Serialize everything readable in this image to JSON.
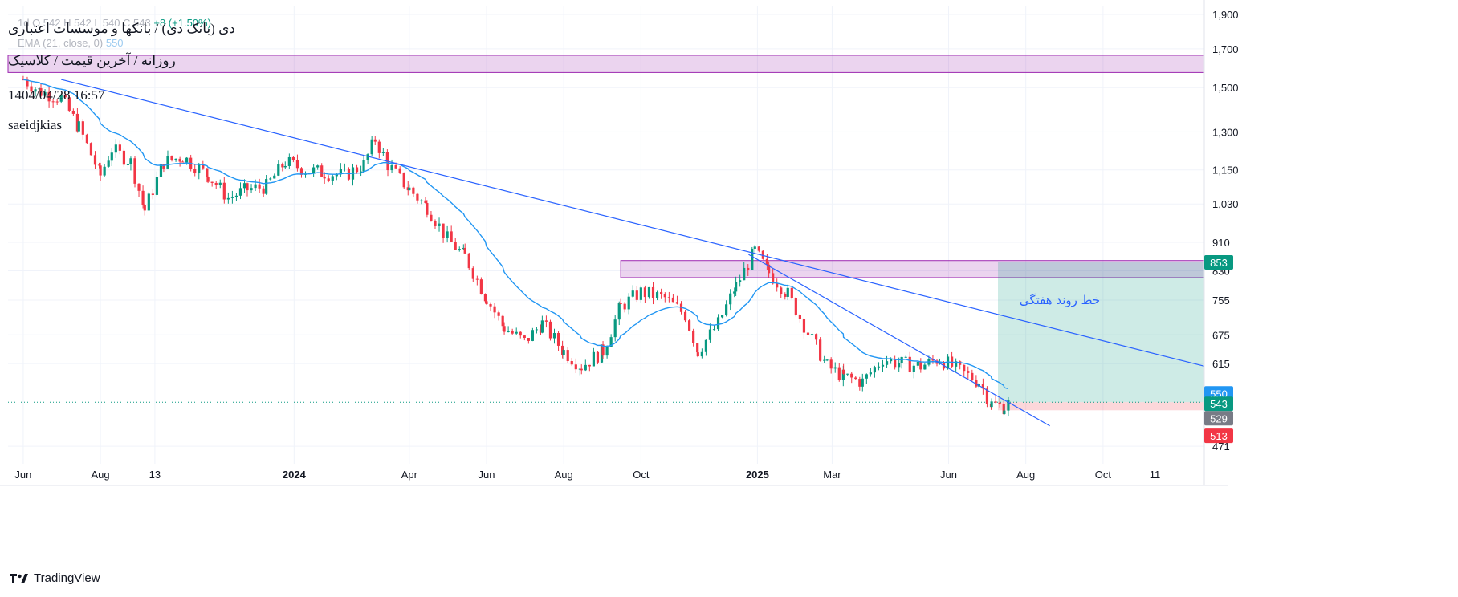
{
  "header": {
    "symbol_ghost": "1d  O  542  H  542  L  540  C  543",
    "change_ghost": "+8 (+1.50%)",
    "ema_label": "EMA (21, close, 0)",
    "ema_value": "550",
    "title_line1": "دی (بانک دی) / بانکها و موسسات اعتباری",
    "title_line2": "روزانه / آخرین قیمت / کلاسیک",
    "datetime": "1404/04/28 16:57",
    "author": "saeidjkias"
  },
  "brand": {
    "name": "TradingView",
    "icon": "tradingview-logo-icon"
  },
  "annotation": {
    "text": "خط روند هفتگی"
  },
  "price_badges": [
    {
      "value": "853",
      "color": "#089981"
    },
    {
      "value": "550",
      "color": "#2196f3"
    },
    {
      "value": "543",
      "color": "#089981"
    },
    {
      "value": "529",
      "color": "#787b86"
    },
    {
      "value": "513",
      "color": "#f23645"
    }
  ],
  "colors": {
    "up": "#089981",
    "down": "#f23645",
    "ema": "#2196f3",
    "trendline": "#2962ff",
    "zone": "#9c27b0",
    "target": "#089981",
    "stop": "#f23645"
  },
  "chart_data": {
    "type": "candlestick",
    "y_scale": "log",
    "ylim": [
      445,
      1950
    ],
    "y_ticks": [
      1900,
      1700,
      1500,
      1300,
      1150,
      1030,
      910,
      830,
      755,
      675,
      615,
      471
    ],
    "y_tick_labels": [
      "1,900",
      "1,700",
      "1,500",
      "1,300",
      "1,150",
      "1,030",
      "910",
      "830",
      "755",
      "675",
      "615",
      "471"
    ],
    "x_range": [
      "2023-05-20",
      "2025-12-20"
    ],
    "x_ticks": [
      {
        "label": "Jun",
        "date": "2023-06-01",
        "bold": false
      },
      {
        "label": "Aug",
        "date": "2023-08-01",
        "bold": false
      },
      {
        "label": "13",
        "date": "2023-09-13",
        "bold": false
      },
      {
        "label": "2024",
        "date": "2024-01-01",
        "bold": true
      },
      {
        "label": "Apr",
        "date": "2024-04-01",
        "bold": false
      },
      {
        "label": "Jun",
        "date": "2024-06-01",
        "bold": false
      },
      {
        "label": "Aug",
        "date": "2024-08-01",
        "bold": false
      },
      {
        "label": "Oct",
        "date": "2024-10-01",
        "bold": false
      },
      {
        "label": "2025",
        "date": "2025-01-01",
        "bold": true
      },
      {
        "label": "Mar",
        "date": "2025-03-01",
        "bold": false
      },
      {
        "label": "Jun",
        "date": "2025-06-01",
        "bold": false
      },
      {
        "label": "Aug",
        "date": "2025-08-01",
        "bold": false
      },
      {
        "label": "Oct",
        "date": "2025-10-01",
        "bold": false
      },
      {
        "label": "11",
        "date": "2025-11-11",
        "bold": false
      }
    ],
    "price_path": [
      [
        "2023-06-01",
        1540
      ],
      [
        "2023-06-15",
        1480
      ],
      [
        "2023-07-01",
        1450
      ],
      [
        "2023-07-15",
        1320
      ],
      [
        "2023-08-01",
        1130
      ],
      [
        "2023-08-10",
        1230
      ],
      [
        "2023-08-25",
        1180
      ],
      [
        "2023-09-05",
        1010
      ],
      [
        "2023-09-20",
        1180
      ],
      [
        "2023-10-05",
        1200
      ],
      [
        "2023-10-25",
        1130
      ],
      [
        "2023-11-10",
        1050
      ],
      [
        "2023-11-25",
        1080
      ],
      [
        "2023-12-10",
        1090
      ],
      [
        "2023-12-25",
        1180
      ],
      [
        "2024-01-10",
        1150
      ],
      [
        "2024-01-25",
        1140
      ],
      [
        "2024-02-10",
        1130
      ],
      [
        "2024-02-25",
        1170
      ],
      [
        "2024-03-05",
        1270
      ],
      [
        "2024-03-15",
        1170
      ],
      [
        "2024-04-01",
        1080
      ],
      [
        "2024-04-15",
        1020
      ],
      [
        "2024-05-01",
        920
      ],
      [
        "2024-05-15",
        870
      ],
      [
        "2024-06-01",
        760
      ],
      [
        "2024-06-15",
        690
      ],
      [
        "2024-07-01",
        660
      ],
      [
        "2024-07-15",
        700
      ],
      [
        "2024-08-01",
        640
      ],
      [
        "2024-08-15",
        610
      ],
      [
        "2024-09-01",
        640
      ],
      [
        "2024-09-15",
        740
      ],
      [
        "2024-10-01",
        775
      ],
      [
        "2024-10-20",
        760
      ],
      [
        "2024-11-05",
        720
      ],
      [
        "2024-11-15",
        640
      ],
      [
        "2024-12-01",
        700
      ],
      [
        "2024-12-15",
        790
      ],
      [
        "2024-12-30",
        885
      ],
      [
        "2025-01-10",
        825
      ],
      [
        "2025-01-25",
        770
      ],
      [
        "2025-02-10",
        680
      ],
      [
        "2025-02-25",
        610
      ],
      [
        "2025-03-10",
        590
      ],
      [
        "2025-03-25",
        580
      ],
      [
        "2025-04-10",
        625
      ],
      [
        "2025-04-25",
        615
      ],
      [
        "2025-05-10",
        610
      ],
      [
        "2025-05-25",
        625
      ],
      [
        "2025-06-10",
        600
      ],
      [
        "2025-06-25",
        580
      ],
      [
        "2025-07-05",
        540
      ],
      [
        "2025-07-15",
        535
      ],
      [
        "2025-07-20",
        543
      ]
    ],
    "ema_21": {
      "period": 21,
      "last": 550
    },
    "trendlines": [
      {
        "name": "weekly-trendline",
        "from": [
          "2023-07-01",
          1540
        ],
        "to": [
          "2025-12-20",
          610
        ]
      },
      {
        "name": "steep-trendline",
        "from": [
          "2024-12-25",
          875
        ],
        "to": [
          "2025-08-20",
          503
        ]
      }
    ],
    "zones": [
      {
        "name": "upper-resistance-zone",
        "from": "2023-05-20",
        "to": "2025-12-20",
        "low": 1575,
        "high": 1665
      },
      {
        "name": "mid-resistance-zone",
        "from": "2024-09-15",
        "to": "2025-12-20",
        "low": 812,
        "high": 858
      }
    ],
    "position": {
      "type": "long",
      "from": "2025-07-10",
      "to": "2025-12-20",
      "entry": 543,
      "target": 853,
      "stop": 529
    },
    "last_price_line": 543
  }
}
